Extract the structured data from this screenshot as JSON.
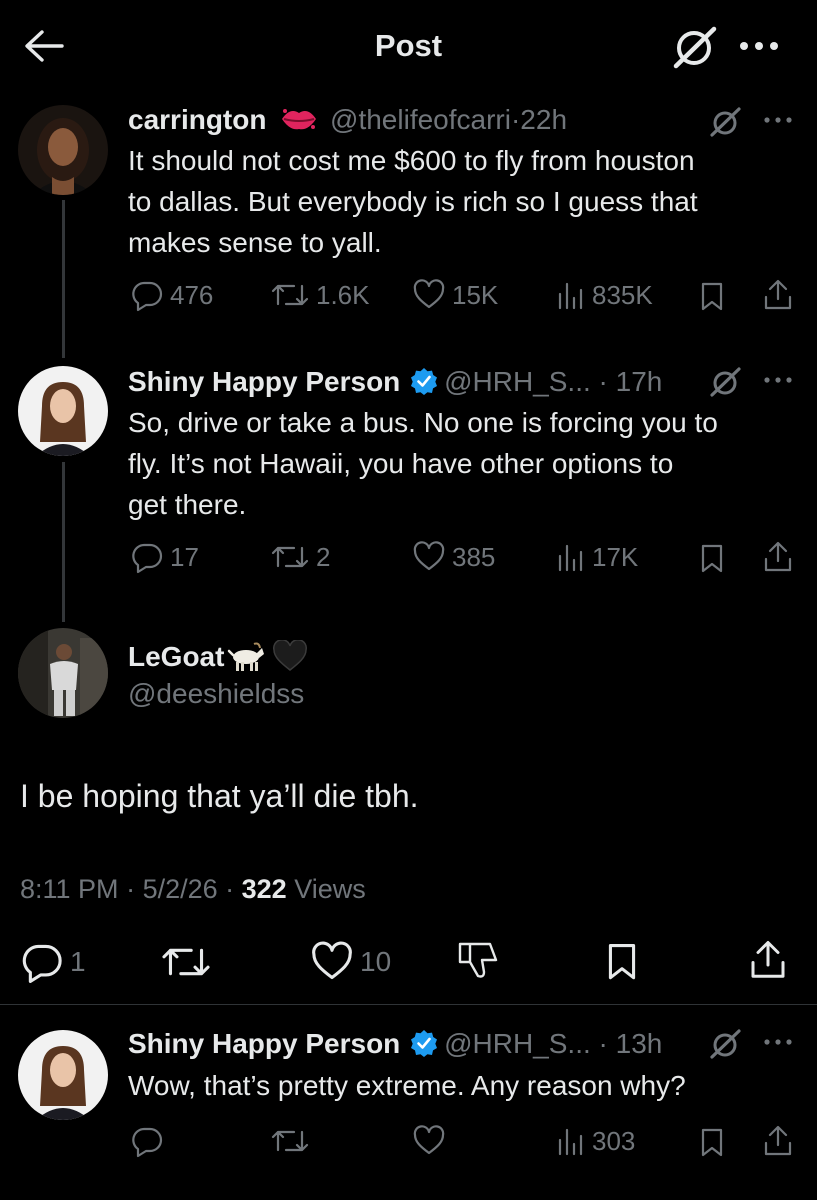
{
  "header": {
    "title": "Post"
  },
  "replies_above": [
    {
      "name": "carrington",
      "handle": "@thelifeofcarri",
      "time": "22h",
      "lines": [
        "It should not cost me $600 to fly from houston",
        "to dallas. But everybody is rich so I guess that",
        "makes sense to yall."
      ],
      "replies": "476",
      "reposts": "1.6K",
      "likes": "15K",
      "views": "835K"
    },
    {
      "name": "Shiny Happy Person",
      "handle": "@HRH_S...",
      "time": "17h",
      "lines": [
        "So, drive or take a bus. No one is forcing you to",
        "fly. It’s not Hawaii, you have other options to",
        "get there."
      ],
      "replies": "17",
      "reposts": "2",
      "likes": "385",
      "views": "17K"
    }
  ],
  "main_post": {
    "name": "LeGoat",
    "handle": "@deeshieldss",
    "text": "I be hoping that ya’ll die tbh.",
    "time": "8:11 PM",
    "date": "5/2/26",
    "views_count": "322",
    "views_label": "Views",
    "replies": "1",
    "likes": "10"
  },
  "reply_below": {
    "name": "Shiny Happy Person",
    "handle": "@HRH_S...",
    "time": "13h",
    "text": "Wow, that’s pretty extreme. Any reason why?",
    "views": "303"
  },
  "colors": {
    "background": "#000000",
    "text": "#e7e9ea",
    "secondary": "#71767b",
    "verified": "#1d9bf0",
    "divider": "#2f3336"
  },
  "icons": [
    "back-arrow-icon",
    "grok-icon",
    "more-icon",
    "lips-emoji",
    "verified-badge-icon",
    "goat-emoji",
    "black-heart-emoji",
    "reply-icon",
    "repost-icon",
    "like-icon",
    "views-icon",
    "bookmark-icon",
    "share-icon",
    "dislike-icon"
  ]
}
